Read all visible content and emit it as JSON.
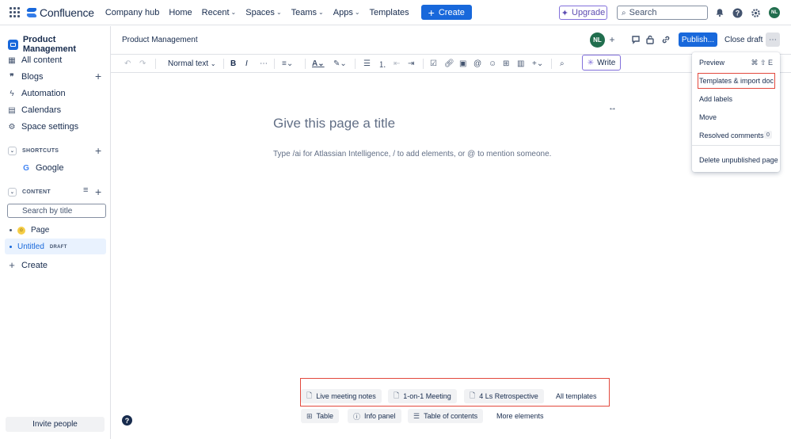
{
  "topnav": {
    "brand": "Confluence",
    "items": [
      {
        "label": "Company hub",
        "chevron": false
      },
      {
        "label": "Home",
        "chevron": false
      },
      {
        "label": "Recent",
        "chevron": true
      },
      {
        "label": "Spaces",
        "chevron": true
      },
      {
        "label": "Teams",
        "chevron": true
      },
      {
        "label": "Apps",
        "chevron": true
      },
      {
        "label": "Templates",
        "chevron": false
      }
    ],
    "create_label": "Create",
    "upgrade_label": "Upgrade",
    "search_placeholder": "Search",
    "avatar_initials": "NL",
    "icons": [
      "app-grid-icon",
      "bell-icon",
      "help-icon",
      "gear-icon"
    ]
  },
  "sidebar": {
    "space_name": "Product Management",
    "items": [
      {
        "label": "All content",
        "icon": "all-content-icon"
      },
      {
        "label": "Blogs",
        "icon": "quote-icon"
      },
      {
        "label": "Automation",
        "icon": "bolt-icon"
      },
      {
        "label": "Calendars",
        "icon": "calendar-icon"
      },
      {
        "label": "Space settings",
        "icon": "gear-icon"
      }
    ],
    "shortcuts_heading": "SHORTCUTS",
    "shortcut_items": [
      {
        "label": "Google",
        "icon": "google-icon"
      }
    ],
    "content_heading": "CONTENT",
    "search_placeholder": "Search by title",
    "tree": [
      {
        "label": "Page",
        "icon": "emoji-icon"
      },
      {
        "label": "Untitled",
        "badge": "DRAFT"
      }
    ],
    "create_label": "Create",
    "invite_label": "Invite people"
  },
  "page_header": {
    "breadcrumb": "Product Management",
    "avatar_initials": "NL",
    "publish_label": "Publish...",
    "close_draft_label": "Close draft"
  },
  "toolbar": {
    "text_style": "Normal text",
    "write_label": "Write"
  },
  "editor": {
    "title_placeholder": "Give this page a title",
    "body_placeholder": "Type /ai for Atlassian Intelligence, / to add elements, or @ to mention someone."
  },
  "menu": {
    "items": [
      {
        "label": "Preview",
        "shortcut": "⌘ ⇧ E"
      },
      {
        "label": "Templates & import doc",
        "highlighted": true
      },
      {
        "label": "Add labels"
      },
      {
        "label": "Move"
      },
      {
        "label": "Resolved comments",
        "badge": "0"
      },
      {
        "label": "Delete unpublished page"
      }
    ]
  },
  "bottom": {
    "templates": [
      "Live meeting notes",
      "1-on-1 Meeting",
      "4 Ls Retrospective"
    ],
    "all_templates_label": "All templates",
    "elements": [
      "Table",
      "Info panel",
      "Table of contents"
    ],
    "more_elements_label": "More elements"
  },
  "colors": {
    "accent": "#1868db",
    "highlight_outline": "#e2483d",
    "ai_purple": "#8270db",
    "avatar_green": "#216e4e"
  }
}
